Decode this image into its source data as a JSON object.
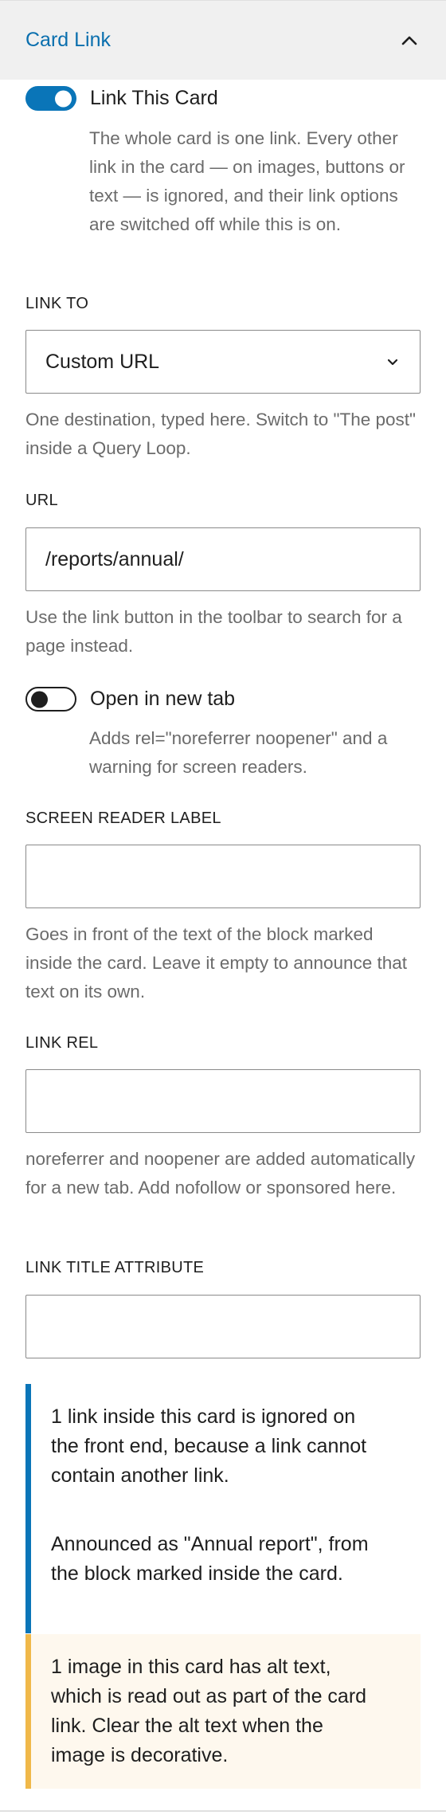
{
  "panel": {
    "title": "Card Link"
  },
  "link_card": {
    "label": "Link This Card",
    "checked": true,
    "help": "The whole card is one link. Every other link in the card — on images, buttons or text — is ignored, and their link options are switched off while this is on."
  },
  "link_to": {
    "label": "LINK TO",
    "value": "Custom URL",
    "help": "One destination, typed here. Switch to \"The post\" inside a Query Loop."
  },
  "url": {
    "label": "URL",
    "value": "/reports/annual/",
    "help": "Use the link button in the toolbar to search for a page instead."
  },
  "new_tab": {
    "label": "Open in new tab",
    "checked": false,
    "help": "Adds rel=\"noreferrer noopener\" and a warning for screen readers."
  },
  "sr_label": {
    "label": "SCREEN READER LABEL",
    "value": "",
    "help": "Goes in front of the text of the block marked inside the card. Leave it empty to announce that text on its own."
  },
  "link_rel": {
    "label": "LINK REL",
    "value": "",
    "help": "noreferrer and noopener are added automatically for a new tab. Add nofollow or sponsored here."
  },
  "title_attr": {
    "label": "LINK TITLE ATTRIBUTE",
    "value": ""
  },
  "info_notice": {
    "line1": "1 link inside this card is ignored on the front end, because a link cannot contain another link.",
    "line2": "Announced as \"Annual report\", from the block marked inside the card."
  },
  "warning_notice": {
    "text": "1 image in this card has alt text, which is read out as part of the card link. Clear the alt text when the image is decorative."
  },
  "colors": {
    "accent": "#0a75b8",
    "title": "#0a6fae",
    "warning": "#f0b849",
    "warning_bg": "#fef8ee"
  },
  "icons": {
    "collapse": "chevron-up-icon",
    "select": "chevron-down-icon"
  }
}
